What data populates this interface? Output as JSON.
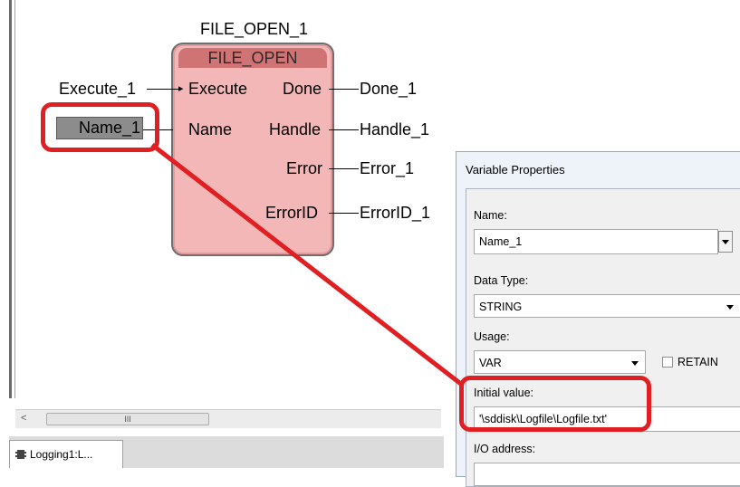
{
  "diagram": {
    "instance_name": "FILE_OPEN_1",
    "block_type": "FILE_OPEN",
    "inputs": [
      {
        "pin": "Execute",
        "variable": "Execute_1"
      },
      {
        "pin": "Name",
        "variable": "Name_1"
      }
    ],
    "outputs": [
      {
        "pin": "Done",
        "variable": "Done_1"
      },
      {
        "pin": "Handle",
        "variable": "Handle_1"
      },
      {
        "pin": "Error",
        "variable": "Error_1"
      },
      {
        "pin": "ErrorID",
        "variable": "ErrorID_1"
      }
    ],
    "highlight_color": "#e01f23",
    "block_color": "#f4b7b8",
    "block_header_color": "#cf7375"
  },
  "dialog": {
    "title": "Variable Properties",
    "name_label": "Name:",
    "name_value": "Name_1",
    "data_type_label": "Data Type:",
    "data_type_value": "STRING",
    "usage_label": "Usage:",
    "usage_value": "VAR",
    "retain_label": "RETAIN",
    "initial_value_label": "Initial value:",
    "initial_value": "'\\sddisk\\Logfile\\Logfile.txt'",
    "io_address_label": "I/O address:"
  },
  "scrollbar": {
    "left_arrow": "<",
    "thumb_grip": "III"
  },
  "tabs": [
    {
      "label": "Logging1:L...",
      "icon": "function-block-icon"
    }
  ]
}
